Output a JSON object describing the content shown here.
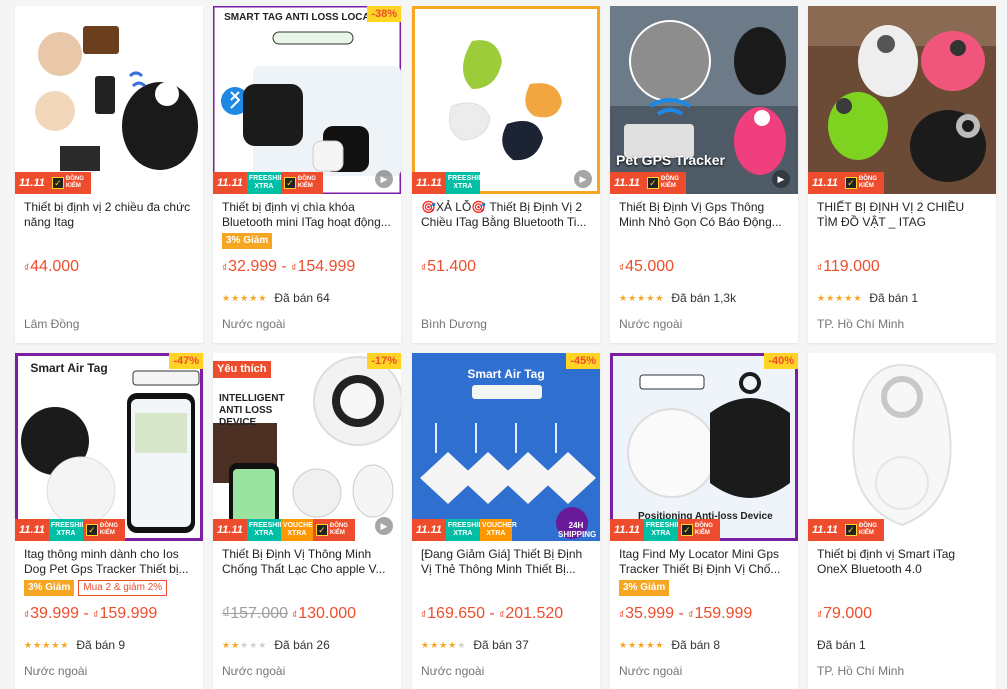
{
  "colors": {
    "price": "#ee4d2d",
    "star": "#f6a623",
    "discount_bg": "#ffd424",
    "promo_orange": "#f6a623"
  },
  "products": [
    {
      "name": "Thiết bị định vị 2 chiều đa chức năng Itag",
      "price": "44.000",
      "currency": "₫",
      "location": "Lâm Đồng",
      "badges": {
        "sale": "11.11",
        "verified": "ĐỒNG KIỂM"
      }
    },
    {
      "name": "Thiết bị định vị chìa khóa Bluetooth mini ITag hoạt động...",
      "discount": "-38%",
      "image_title": "SMART TAG ANTI LOSS LOCATOR",
      "promo": "3% Giảm",
      "price_low": "32.999",
      "price_high": "154.999",
      "currency": "₫",
      "sold": "Đã bán 64",
      "rating": 5,
      "location": "Nước ngoài",
      "badges": {
        "sale": "11.11",
        "freeship": "FREESHIP XTRA",
        "verified": "ĐỒNG KIỂM"
      }
    },
    {
      "name": "🎯XẢ LỖ🎯 Thiết Bị Định Vị 2 Chiều ITag Bằng Bluetooth Ti...",
      "price": "51.400",
      "currency": "₫",
      "location": "Bình Dương",
      "badges": {
        "sale": "11.11",
        "freeship": "FREESHIP XTRA"
      }
    },
    {
      "name": "Thiết Bị Định Vị Gps Thông Minh Nhỏ Gọn Có Báo Động...",
      "image_caption": "Pet GPS Tracker",
      "price": "45.000",
      "currency": "₫",
      "sold": "Đã bán 1,3k",
      "rating": 4.5,
      "location": "Nước ngoài",
      "badges": {
        "sale": "11.11",
        "verified": "ĐỒNG KIỂM"
      }
    },
    {
      "name": "THIẾT BỊ ĐỊNH VỊ 2 CHIỀU TÌM ĐỒ VẬT _ ITAG",
      "price": "119.000",
      "currency": "₫",
      "sold": "Đã bán 1",
      "rating": 5,
      "location": "TP. Hồ Chí Minh",
      "badges": {
        "sale": "11.11",
        "verified": "ĐỒNG KIỂM"
      }
    },
    {
      "name": "Itag thông minh dành cho Ios Dog Pet Gps Tracker Thiết bị...",
      "discount": "-47%",
      "image_title": "Smart Air Tag",
      "promo": "3% Giảm",
      "promo2": "Mua 2 & giảm 2%",
      "price_low": "39.999",
      "price_high": "159.999",
      "currency": "₫",
      "sold": "Đã bán 9",
      "rating": 5,
      "location": "Nước ngoài",
      "badges": {
        "sale": "11.11",
        "freeship": "FREESHIP XTRA",
        "verified": "ĐỒNG KIỂM"
      }
    },
    {
      "name": "Thiết Bị Định Vị Thông Minh Chống Thất Lạc Cho apple V...",
      "favorite": "Yêu thích",
      "discount": "-17%",
      "image_title": "INTELLIGENT ANTI LOSS DEVICE",
      "price_old": "157.000",
      "price": "130.000",
      "currency": "₫",
      "sold": "Đã bán 26",
      "rating": 2,
      "location": "Nước ngoài",
      "badges": {
        "sale": "11.11",
        "freeship": "FREESHIP XTRA",
        "voucher": "VOUCHER XTRA",
        "verified": "ĐỒNG KIỂM"
      }
    },
    {
      "name": "[Đang Giảm Giá] Thiết Bị Định Vị Thẻ Thông Minh Thiết Bị...",
      "discount": "-45%",
      "image_title": "Smart Air Tag",
      "price_low": "169.650",
      "price_high": "201.520",
      "currency": "₫",
      "sold": "Đã bán 37",
      "rating": 4,
      "location": "Nước ngoài",
      "badges": {
        "sale": "11.11",
        "freeship": "FREESHIP XTRA",
        "voucher": "VOUCHER XTRA",
        "shipping": "24H SHIPPING"
      }
    },
    {
      "name": "Itag Find My Locator Mini Gps Tracker Thiết Bị Định Vị Chố...",
      "discount": "-40%",
      "image_caption": "Positioning Anti-loss Device",
      "promo": "3% Giảm",
      "price_low": "35.999",
      "price_high": "159.999",
      "currency": "₫",
      "sold": "Đã bán 8",
      "rating": 5,
      "location": "Nước ngoài",
      "badges": {
        "sale": "11.11",
        "freeship": "FREESHIP XTRA",
        "verified": "ĐỒNG KIỂM"
      }
    },
    {
      "name": "Thiết bị định vị Smart iTag OneX Bluetooth 4.0",
      "price": "79.000",
      "currency": "₫",
      "sold": "Đã bán 1",
      "location": "TP. Hồ Chí Minh",
      "badges": {
        "sale": "11.11",
        "verified": "ĐỒNG KIỂM"
      }
    }
  ]
}
